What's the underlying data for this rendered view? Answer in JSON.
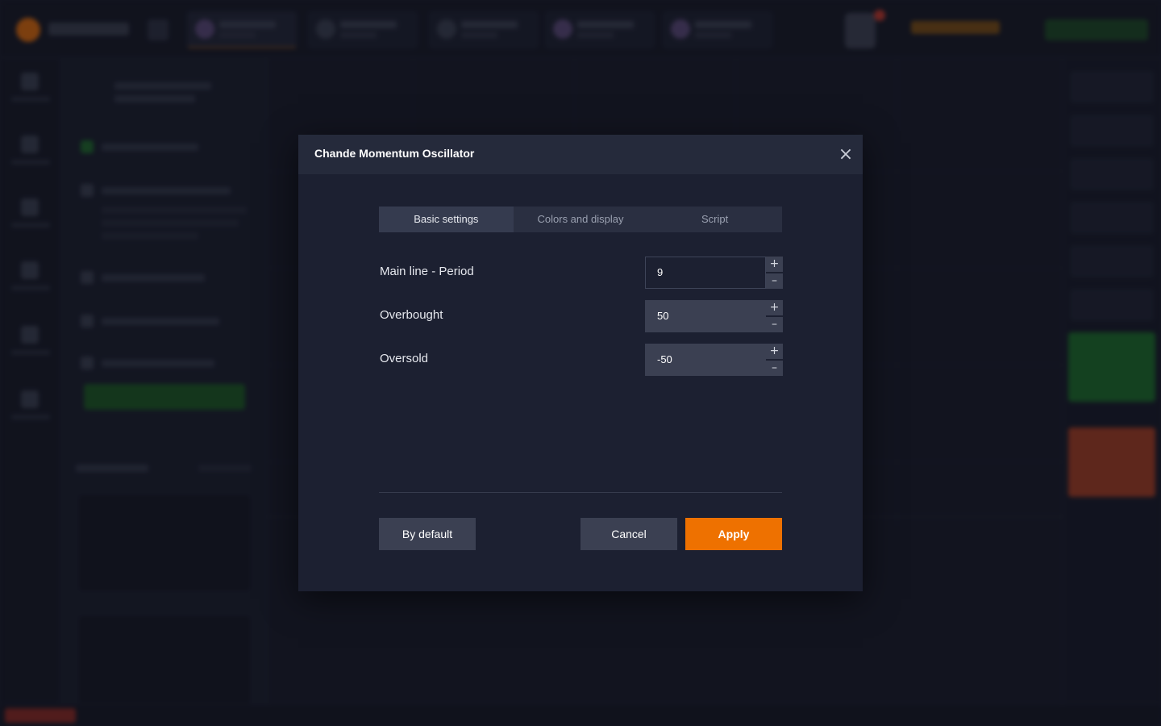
{
  "modal": {
    "title": "Chande Momentum Oscillator",
    "close_icon": "close-icon",
    "tabs": [
      {
        "label": "Basic settings",
        "active": true
      },
      {
        "label": "Colors and display",
        "active": false
      },
      {
        "label": "Script",
        "active": false
      }
    ],
    "fields": [
      {
        "label": "Main line - Period",
        "value": "9"
      },
      {
        "label": "Overbought",
        "value": "50"
      },
      {
        "label": "Oversold",
        "value": "-50"
      }
    ],
    "stepper": {
      "plus": "+",
      "minus": "–"
    },
    "buttons": {
      "by_default": "By default",
      "cancel": "Cancel",
      "apply": "Apply"
    }
  },
  "colors": {
    "accent": "#ee7100",
    "modal_bg": "#1c2031",
    "header_bg": "#252a3b"
  }
}
